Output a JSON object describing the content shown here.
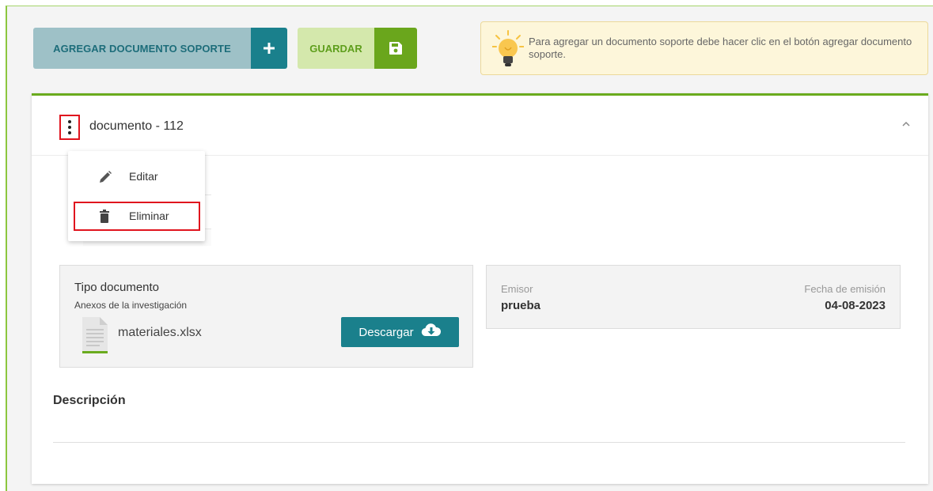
{
  "toolbar": {
    "add_label": "AGREGAR DOCUMENTO SOPORTE",
    "add_icon": "plus-icon",
    "save_label": "GUARDAR",
    "save_icon": "floppy-disk-icon"
  },
  "info": {
    "icon": "lightbulb-icon",
    "message": "Para agregar un documento soporte debe hacer clic en el botón agregar documento soporte."
  },
  "card": {
    "title": "documento - 112",
    "collapse_icon": "chevron-up-icon"
  },
  "menu": {
    "edit_label": "Editar",
    "delete_label": "Eliminar"
  },
  "document": {
    "type_label": "Tipo documento",
    "type_value": "Anexos de la investigación",
    "file_name": "materiales.xlsx",
    "download_label": "Descargar"
  },
  "issuer": {
    "label": "Emisor",
    "value": "prueba",
    "date_label": "Fecha de emisión",
    "date_value": "04-08-2023"
  },
  "description": {
    "title": "Descripción"
  },
  "colors": {
    "primary_teal": "#1a808c",
    "save_green": "#6aa61c",
    "card_accent": "#6aab1e",
    "highlight_red": "#e0141e"
  }
}
